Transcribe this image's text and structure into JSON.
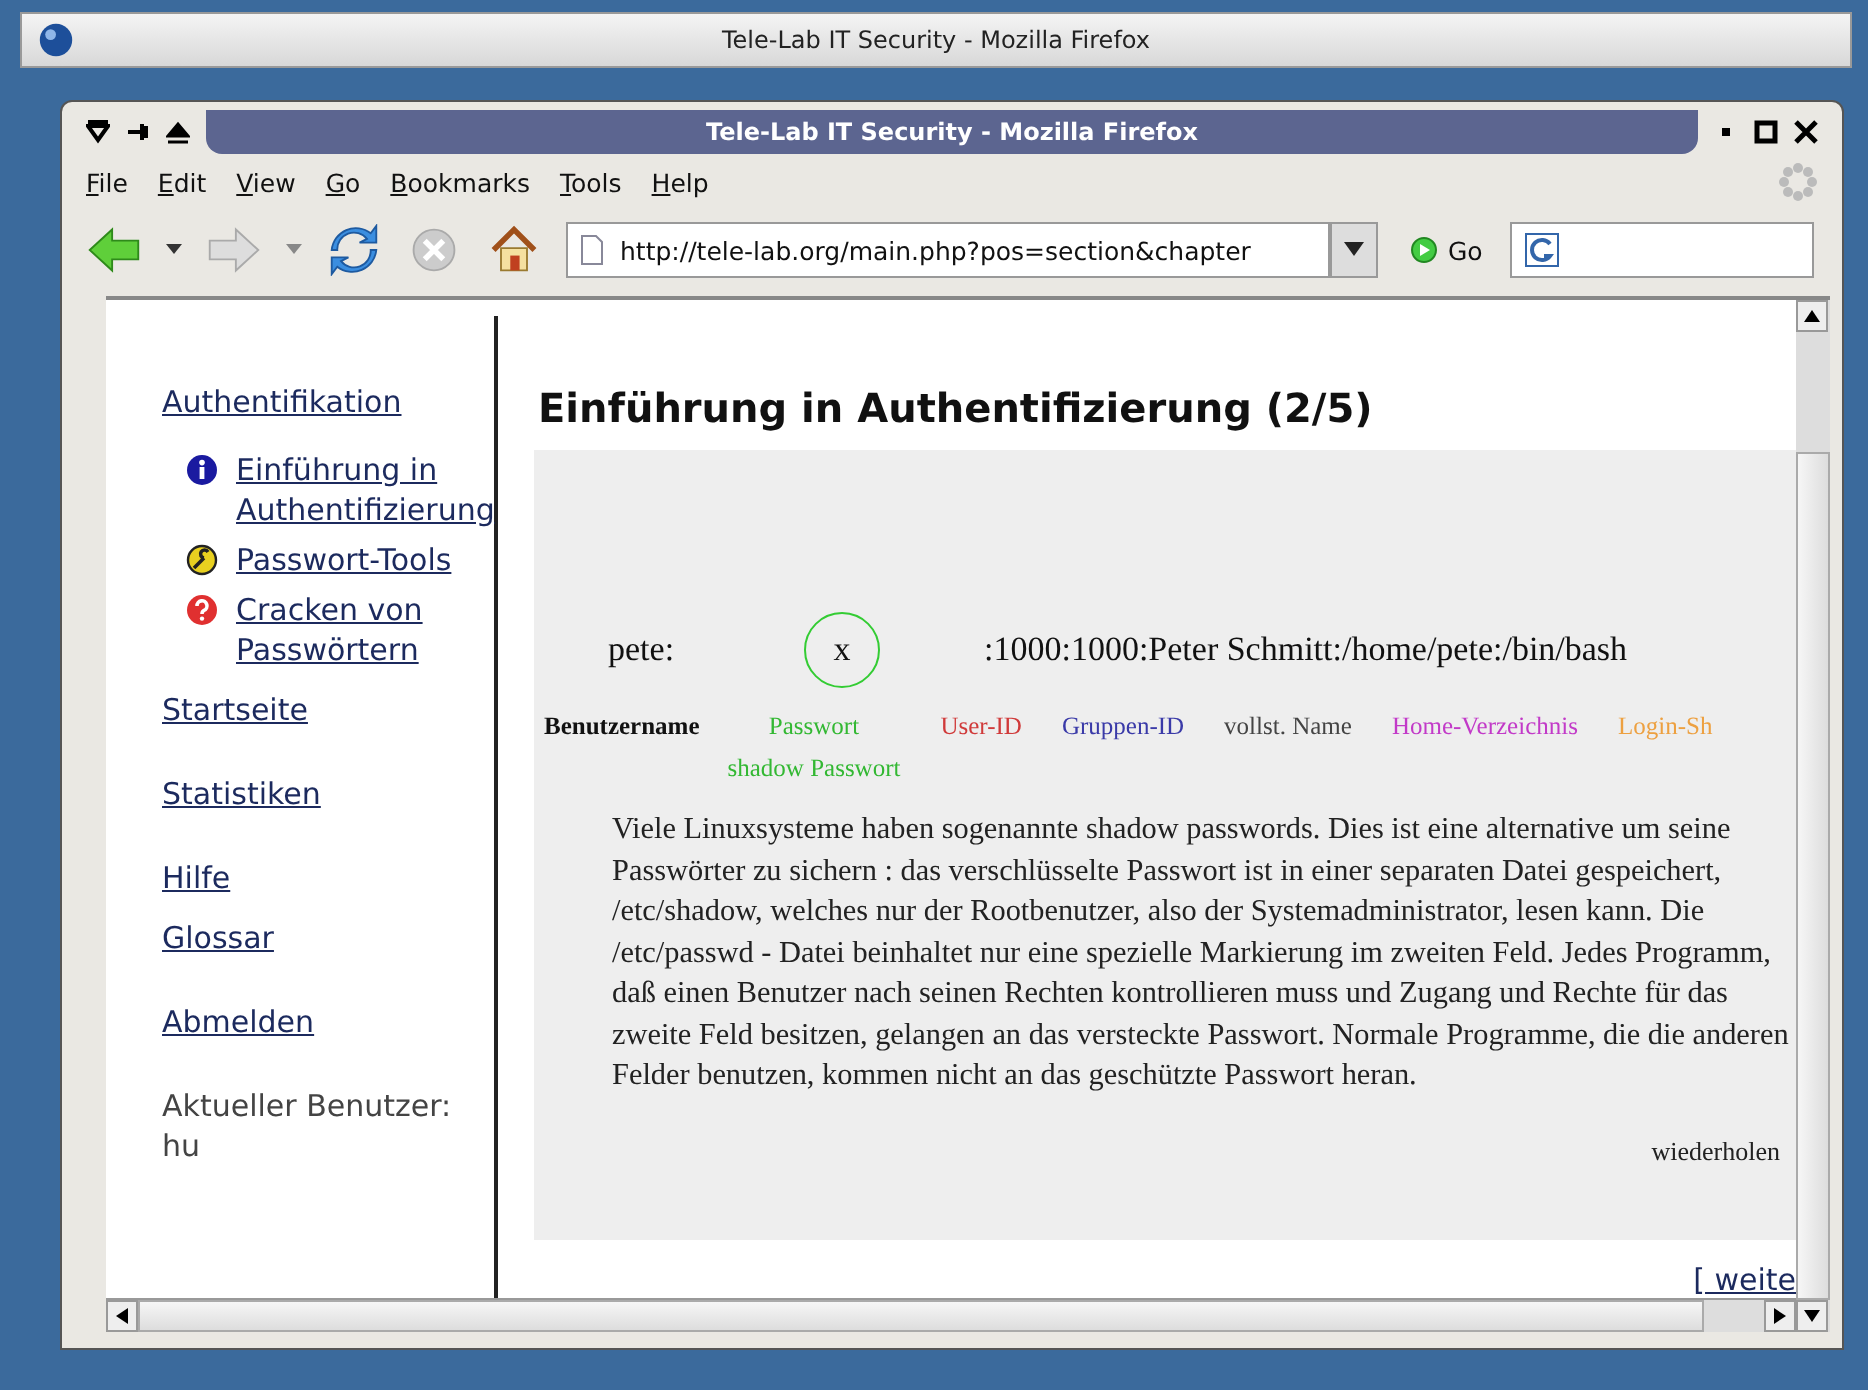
{
  "outer_window": {
    "title": "Tele-Lab IT Security - Mozilla Firefox"
  },
  "window": {
    "title": "Tele-Lab IT Security - Mozilla Firefox"
  },
  "menu": [
    "File",
    "Edit",
    "View",
    "Go",
    "Bookmarks",
    "Tools",
    "Help"
  ],
  "toolbar": {
    "address": "http://tele-lab.org/main.php?pos=section&chapter",
    "go": "Go"
  },
  "sidebar": {
    "items": [
      {
        "label": "Authentifikation",
        "children": [
          {
            "kind": "info",
            "label": "Einführung in Authentifizierung"
          },
          {
            "kind": "tool",
            "label": "Passwort-Tools"
          },
          {
            "kind": "help",
            "label": "Cracken von Passwörtern"
          }
        ]
      },
      {
        "label": "Startseite"
      },
      {
        "label": "Statistiken"
      },
      {
        "label": "Hilfe"
      },
      {
        "label": "Glossar"
      },
      {
        "label": "Abmelden"
      }
    ],
    "user": "Aktueller Benutzer: hu"
  },
  "content": {
    "heading": "Einführung in Authentifizierung (2/5)",
    "passwd_line": {
      "user": "pete:",
      "password": "x",
      "rest": ":1000:1000:Peter Schmitt:/home/pete:/bin/bash"
    },
    "fields": [
      {
        "label": "Benutzername",
        "color": "#111111"
      },
      {
        "label": "Passwort",
        "sublabel": "shadow Passwort",
        "color": "#33b833"
      },
      {
        "label": "User-ID",
        "color": "#d03a3a"
      },
      {
        "label": "Gruppen-ID",
        "color": "#3a3aa8"
      },
      {
        "label": "vollst. Name",
        "color": "#444444"
      },
      {
        "label": "Home-Verzeichnis",
        "color": "#c23ac8"
      },
      {
        "label": "Login-Sh",
        "color": "#eda040"
      }
    ],
    "paragraph": "Viele Linuxsysteme haben sogenannte shadow passwords. Dies ist eine alternative um seine Passwörter zu sichern : das verschlüsselte Passwort ist in einer separaten Datei gespeichert, /etc/shadow, welches nur der Rootbenutzer, also der Systemadministrator, lesen kann. Die /etc/passwd - Datei beinhaltet nur eine spezielle Markierung im zweiten Feld. Jedes Programm, daß einen Benutzer nach seinen Rechten kontrollieren muss und Zugang und Rechte für das zweite Feld besitzen, gelangen an das versteckte Passwort. Normale Programme, die die anderen Felder benutzen, kommen nicht an das geschützte Passwort heran.",
    "repeat_link": "wiederholen",
    "next_link": "[ weite"
  }
}
